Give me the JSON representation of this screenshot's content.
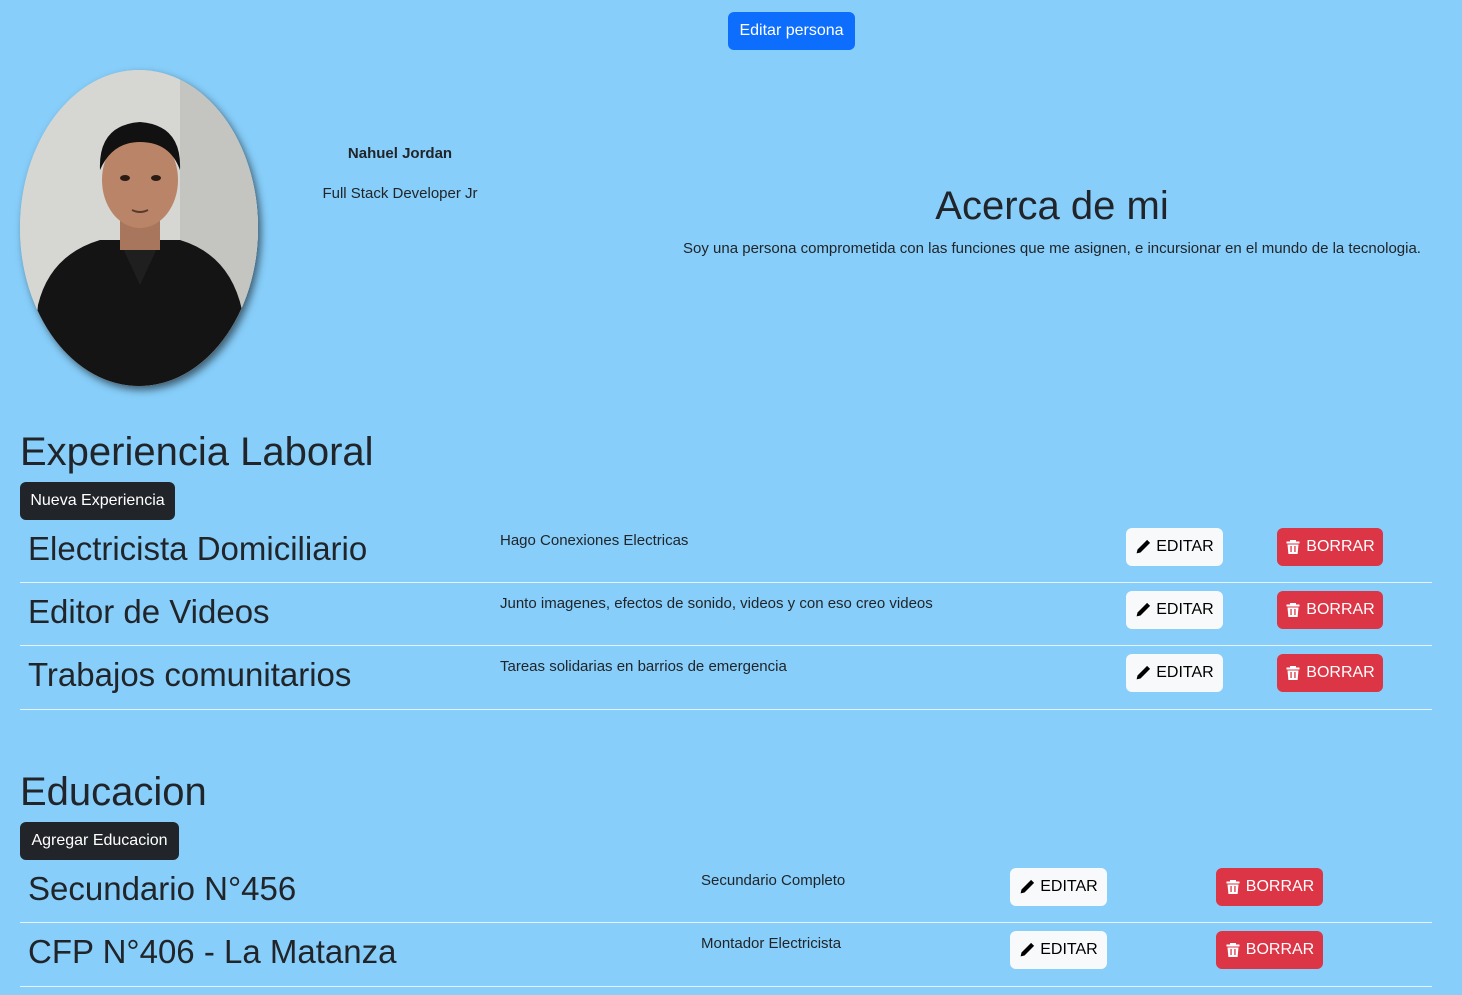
{
  "header": {
    "edit_person_label": "Editar persona"
  },
  "profile": {
    "name": "Nahuel Jordan",
    "title": "Full Stack Developer Jr"
  },
  "about": {
    "heading": "Acerca de mi",
    "text": "Soy una persona comprometida con las funciones que me asignen, e incursionar en el mundo de la tecnologia."
  },
  "experience": {
    "heading": "Experiencia Laboral",
    "new_label": "Nueva Experiencia",
    "items": [
      {
        "title": "Electricista Domiciliario",
        "description": "Hago Conexiones Electricas",
        "edit_label": "EDITAR",
        "delete_label": "BORRAR"
      },
      {
        "title": "Editor de Videos",
        "description": "Junto imagenes, efectos de sonido, videos y con eso creo videos",
        "edit_label": "EDITAR",
        "delete_label": "BORRAR"
      },
      {
        "title": "Trabajos comunitarios",
        "description": "Tareas solidarias en barrios de emergencia",
        "edit_label": "EDITAR",
        "delete_label": "BORRAR"
      }
    ]
  },
  "education": {
    "heading": "Educacion",
    "new_label": "Agregar Educacion",
    "items": [
      {
        "title": "Secundario N°456",
        "description": "Secundario Completo",
        "edit_label": "EDITAR",
        "delete_label": "BORRAR"
      },
      {
        "title": "CFP N°406 - La Matanza",
        "description": "Montador Electricista",
        "edit_label": "EDITAR",
        "delete_label": "BORRAR"
      }
    ]
  },
  "icons": {
    "edit": "pencil-icon",
    "delete": "trash-icon"
  },
  "colors": {
    "background": "#87cefa",
    "primary": "#0d6efd",
    "dark": "#212529",
    "light": "#f8f9fa",
    "danger": "#dc3545"
  }
}
